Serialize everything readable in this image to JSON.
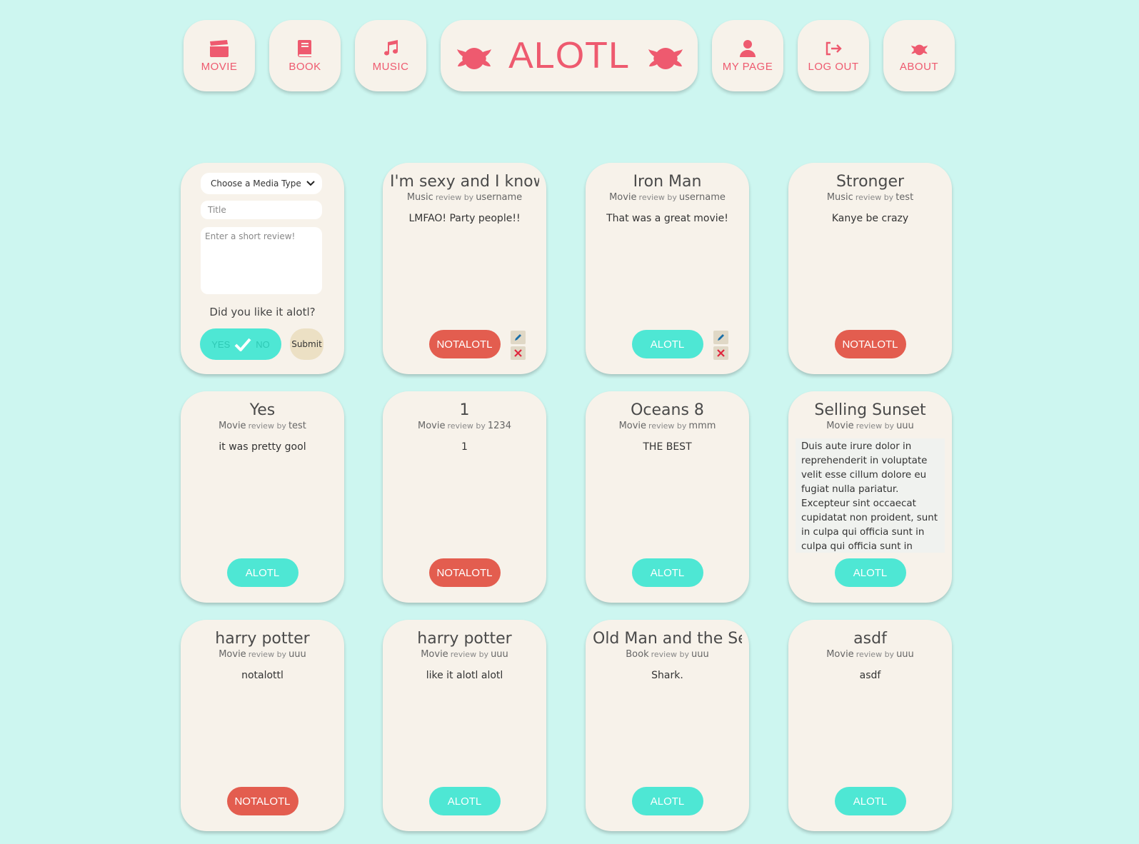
{
  "nav": {
    "movie": "MOVIE",
    "book": "BOOK",
    "music": "MUSIC",
    "brand": "ALOTL",
    "mypage": "MY PAGE",
    "logout": "LOG OUT",
    "about": "ABOUT"
  },
  "form": {
    "media_type": "Choose a Media Type",
    "title_placeholder": "Title",
    "review_placeholder": "Enter a short review!",
    "question": "Did you like it alotl?",
    "toggle_yes": "YES",
    "toggle_no": "NO",
    "submit": "Submit"
  },
  "review_by_label": "review by",
  "reviews": [
    {
      "title": "I'm sexy and I know it",
      "type": "Music",
      "user": "username",
      "text": "LMFAO! Party people!!",
      "verdict": "NOTALOTL"
    },
    {
      "title": "Iron Man",
      "type": "Movie",
      "user": "username",
      "text": "That was a great movie!",
      "verdict": "ALOTL"
    },
    {
      "title": "Stronger",
      "type": "Music",
      "user": "test",
      "text": "Kanye be crazy",
      "verdict": "NOTALOTL"
    },
    {
      "title": "Yes",
      "type": "Movie",
      "user": "test",
      "text": "it was pretty gool",
      "verdict": "ALOTL"
    },
    {
      "title": "1",
      "type": "Movie",
      "user": "1234",
      "text": "1",
      "verdict": "NOTALOTL"
    },
    {
      "title": "Oceans 8",
      "type": "Movie",
      "user": "mmm",
      "text": "THE BEST",
      "verdict": "ALOTL"
    },
    {
      "title": "Selling Sunset",
      "type": "Movie",
      "user": "uuu",
      "text": "Duis aute irure dolor in reprehenderit in voluptate velit esse cillum dolore eu fugiat nulla pariatur. Excepteur sint occaecat cupidatat non proident, sunt in culpa qui officia sunt in culpa qui officia sunt in culpa deserunt mollit anim id est laborum.",
      "verdict": "ALOTL"
    },
    {
      "title": "harry potter",
      "type": "Movie",
      "user": "uuu",
      "text": "notalottl",
      "verdict": "NOTALOTL"
    },
    {
      "title": "harry potter",
      "type": "Movie",
      "user": "uuu",
      "text": "like it alotl alotl",
      "verdict": "ALOTL"
    },
    {
      "title": "Old Man and the Sea",
      "type": "Book",
      "user": "uuu",
      "text": "Shark.",
      "verdict": "ALOTL"
    },
    {
      "title": "asdf",
      "type": "Movie",
      "user": "uuu",
      "text": "asdf",
      "verdict": "ALOTL"
    }
  ],
  "colors": {
    "background": "#cdf6f0",
    "card": "#f7f2ea",
    "brand": "#ee5a6f",
    "alotl": "#4ee7d4",
    "notalotl": "#e35d4f"
  }
}
